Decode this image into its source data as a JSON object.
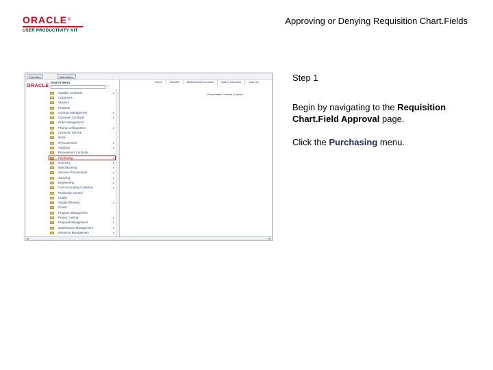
{
  "header": {
    "logo_wordmark": "ORACLE",
    "logo_registered": "®",
    "logo_subtitle": "USER PRODUCTIVITY KIT",
    "title": "Approving or Denying Requisition Chart.Fields"
  },
  "colors": {
    "brand_red": "#e2001a",
    "menu_link": "#2d4670",
    "highlight": "#e00000"
  },
  "screenshot": {
    "tabs": [
      "Favorites",
      "Main Menu"
    ],
    "brand": "ORACLE",
    "header_links": [
      "Home",
      "Worklist",
      "MultiChannel Console",
      "Add to Favorites",
      "Sign out"
    ],
    "personalize": "Personalize Content | Layout",
    "menu": {
      "title": "Search Menu:",
      "go_icon": "go-arrow-icon",
      "items": [
        {
          "label": "Supplier Contracts",
          "arrow": "▸",
          "icon": "folder-icon"
        },
        {
          "label": "Customers",
          "arrow": "",
          "icon": "folder-icon"
        },
        {
          "label": "Vendors",
          "arrow": "",
          "icon": "folder-icon"
        },
        {
          "label": "Products",
          "arrow": "",
          "icon": "folder-icon"
        },
        {
          "label": "Contract Management",
          "arrow": "▸",
          "icon": "folder-icon"
        },
        {
          "label": "Customer Contracts",
          "arrow": "▸",
          "icon": "folder-icon"
        },
        {
          "label": "Order Management",
          "arrow": "",
          "icon": "folder-icon"
        },
        {
          "label": "Pricing Configuration",
          "arrow": "▸",
          "icon": "folder-icon"
        },
        {
          "label": "Customer Service",
          "arrow": "",
          "icon": "folder-icon"
        },
        {
          "label": "Items",
          "arrow": "",
          "icon": "folder-icon"
        },
        {
          "label": "eProcurement",
          "arrow": "▸",
          "icon": "folder-icon"
        },
        {
          "label": "Catalogs",
          "arrow": "▸",
          "icon": "folder-icon"
        },
        {
          "label": "Procurement Contracts",
          "arrow": "",
          "icon": "folder-icon"
        },
        {
          "label": "Purchasing",
          "arrow": "▸",
          "icon": "folder-icon",
          "highlight": true
        },
        {
          "label": "Inventory",
          "arrow": "▸",
          "icon": "folder-icon"
        },
        {
          "label": "Manufacturing",
          "arrow": "▸",
          "icon": "folder-icon"
        },
        {
          "label": "Services Procurement",
          "arrow": "▸",
          "icon": "folder-icon"
        },
        {
          "label": "Sourcing",
          "arrow": "▸",
          "icon": "folder-icon"
        },
        {
          "label": "Engineering",
          "arrow": "▸",
          "icon": "folder-icon"
        },
        {
          "label": "Cost Accounting Collection",
          "arrow": "▸",
          "icon": "folder-icon"
        },
        {
          "label": "Production Control",
          "arrow": "",
          "icon": "folder-icon"
        },
        {
          "label": "Quality",
          "arrow": "",
          "icon": "folder-icon"
        },
        {
          "label": "Supply Planning",
          "arrow": "▸",
          "icon": "folder-icon"
        },
        {
          "label": "Grants",
          "arrow": "",
          "icon": "folder-icon"
        },
        {
          "label": "Program Management",
          "arrow": "",
          "icon": "folder-icon"
        },
        {
          "label": "Project Costing",
          "arrow": "▸",
          "icon": "folder-icon"
        },
        {
          "label": "Proposal Management",
          "arrow": "▸",
          "icon": "folder-icon"
        },
        {
          "label": "Maintenance Management",
          "arrow": "▸",
          "icon": "folder-icon"
        },
        {
          "label": "Resource Management",
          "arrow": "▸",
          "icon": "folder-icon"
        }
      ]
    }
  },
  "instructions": {
    "step": "Step 1",
    "para1_prefix": "Begin by navigating to the ",
    "para1_bold": "Requisition Chart.Field Approval",
    "para1_suffix": " page.",
    "para2_prefix": "Click the ",
    "para2_bold": "Purchasing",
    "para2_suffix": " menu."
  }
}
